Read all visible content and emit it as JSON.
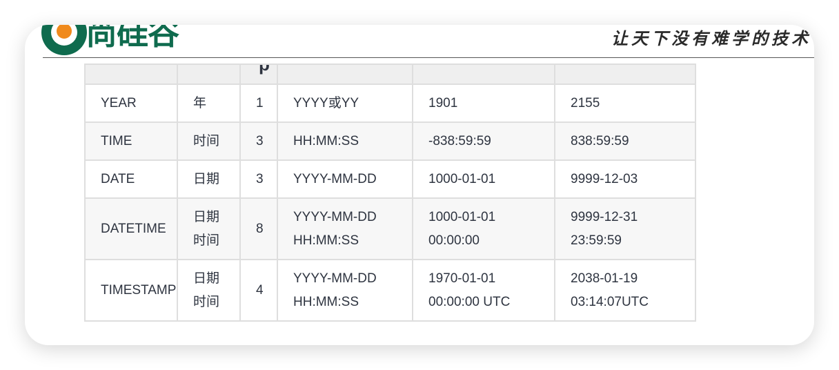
{
  "header": {
    "brand": "尚硅谷",
    "slogan": "让天下没有难学的技术"
  },
  "table": {
    "header_fragment": "p",
    "rows": [
      {
        "type": "YEAR",
        "meaning": [
          "年"
        ],
        "bytes": "1",
        "format": [
          "YYYY或YY"
        ],
        "min": [
          "1901"
        ],
        "max": [
          "2155"
        ]
      },
      {
        "type": "TIME",
        "meaning": [
          "时间"
        ],
        "bytes": "3",
        "format": [
          "HH:MM:SS"
        ],
        "min": [
          "-838:59:59"
        ],
        "max": [
          "838:59:59"
        ]
      },
      {
        "type": "DATE",
        "meaning": [
          "日期"
        ],
        "bytes": "3",
        "format": [
          "YYYY-MM-DD"
        ],
        "min": [
          "1000-01-01"
        ],
        "max": [
          "9999-12-03"
        ]
      },
      {
        "type": "DATETIME",
        "meaning": [
          "日期",
          "时间"
        ],
        "bytes": "8",
        "format": [
          "YYYY-MM-DD",
          "HH:MM:SS"
        ],
        "min": [
          "1000-01-01",
          "00:00:00"
        ],
        "max": [
          "9999-12-31",
          "23:59:59"
        ]
      },
      {
        "type": "TIMESTAMP",
        "meaning": [
          "日期",
          "时间"
        ],
        "bytes": "4",
        "format": [
          "YYYY-MM-DD",
          "HH:MM:SS"
        ],
        "min": [
          "1970-01-01",
          "00:00:00 UTC"
        ],
        "max": [
          "2038-01-19",
          "03:14:07UTC"
        ]
      }
    ]
  },
  "colors": {
    "brand_green": "#0f6b4e",
    "brand_orange": "#f08a1c",
    "header_bg": "#efefef",
    "border": "#dedede"
  }
}
